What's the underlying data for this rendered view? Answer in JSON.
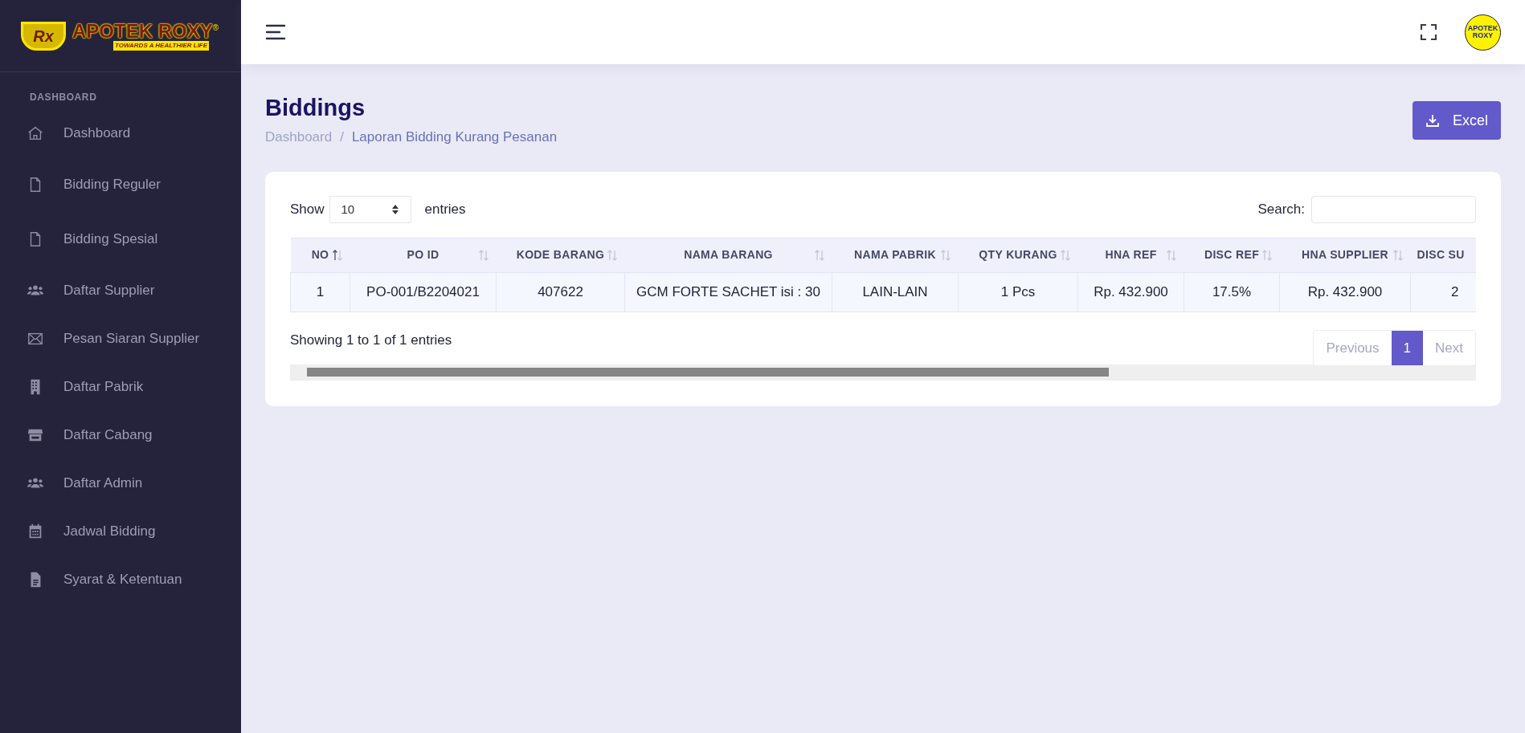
{
  "logo": {
    "name": "APOTEK ROXY",
    "mark": "®",
    "tagline": "TOWARDS A HEALTHIER LIFE",
    "badge": "Rx"
  },
  "sidebar": {
    "section": "DASHBOARD",
    "items": [
      {
        "label": "Dashboard"
      },
      {
        "label": "Bidding Reguler"
      },
      {
        "label": "Bidding Spesial"
      },
      {
        "label": "Daftar Supplier"
      },
      {
        "label": "Pesan Siaran Supplier"
      },
      {
        "label": "Daftar Pabrik"
      },
      {
        "label": "Daftar Cabang"
      },
      {
        "label": "Daftar Admin"
      },
      {
        "label": "Jadwal Bidding"
      },
      {
        "label": "Syarat & Ketentuan"
      }
    ]
  },
  "header": {
    "avatar_lines": [
      "APOTEK",
      "ROXY"
    ]
  },
  "page": {
    "title": "Biddings",
    "breadcrumb": [
      "Dashboard",
      "/",
      "Laporan Bidding Kurang Pesanan"
    ],
    "export_button": "Excel"
  },
  "table_controls": {
    "show_label": "Show",
    "page_size": "10",
    "entries_label": "entries",
    "search_label": "Search:"
  },
  "table": {
    "columns": [
      {
        "label": "NO",
        "sorted_ascending": true
      },
      {
        "label": "PO ID",
        "sorted_ascending": false
      },
      {
        "label": "KODE BARANG",
        "sorted_ascending": false
      },
      {
        "label": "NAMA BARANG",
        "sorted_ascending": false
      },
      {
        "label": "NAMA PABRIK",
        "sorted_ascending": false
      },
      {
        "label": "QTY KURANG",
        "sorted_ascending": false
      },
      {
        "label": "HNA REF",
        "sorted_ascending": false
      },
      {
        "label": "DISC REF",
        "sorted_ascending": false
      },
      {
        "label": "HNA SUPPLIER",
        "sorted_ascending": false
      },
      {
        "label": "DISC SU"
      }
    ],
    "rows": [
      [
        "1",
        "PO-001/B2204021",
        "407622",
        "GCM FORTE SACHET isi : 30",
        "LAIN-LAIN",
        "1 Pcs",
        "Rp. 432.900",
        "17.5%",
        "Rp. 432.900",
        "2"
      ]
    ]
  },
  "footer": {
    "info": "Showing 1 to 1 of 1 entries",
    "pagination": [
      {
        "label": "Previous",
        "selected": false
      },
      {
        "label": "1",
        "selected": true
      },
      {
        "label": "Next",
        "selected": false
      }
    ]
  }
}
